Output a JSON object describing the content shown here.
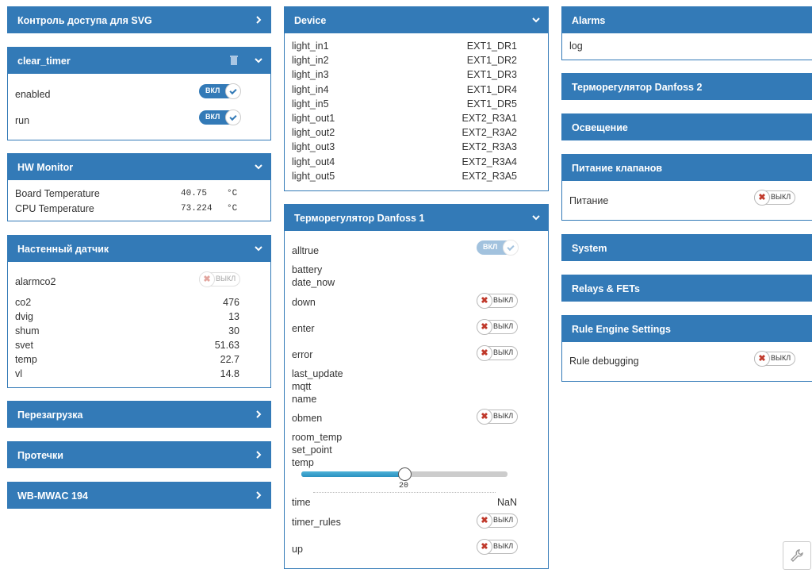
{
  "col1": {
    "svg_access": {
      "title": "Контроль доступа для SVG"
    },
    "clear_timer": {
      "title": "clear_timer",
      "rows": [
        {
          "label": "enabled",
          "toggle": "ВКЛ"
        },
        {
          "label": "run",
          "toggle": "ВКЛ"
        }
      ]
    },
    "hw_monitor": {
      "title": "HW Monitor",
      "rows": [
        {
          "label": "Board Temperature",
          "value": "40.75",
          "unit": "°C"
        },
        {
          "label": "CPU Temperature",
          "value": "73.224",
          "unit": "°C"
        }
      ]
    },
    "wall_sensor": {
      "title": "Настенный датчик",
      "alarm": {
        "label": "alarmco2",
        "toggle": "ВЫКЛ"
      },
      "rows": [
        {
          "label": "co2",
          "value": "476"
        },
        {
          "label": "dvig",
          "value": "13"
        },
        {
          "label": "shum",
          "value": "30"
        },
        {
          "label": "svet",
          "value": "51.63"
        },
        {
          "label": "temp",
          "value": "22.7"
        },
        {
          "label": "vl",
          "value": "14.8"
        }
      ]
    },
    "reboot": {
      "title": "Перезагрузка"
    },
    "leaks": {
      "title": "Протечки"
    },
    "mwac": {
      "title": "WB-MWAC 194"
    }
  },
  "col2": {
    "device": {
      "title": "Device",
      "rows": [
        {
          "label": "light_in1",
          "value": "EXT1_DR1"
        },
        {
          "label": "light_in2",
          "value": "EXT1_DR2"
        },
        {
          "label": "light_in3",
          "value": "EXT1_DR3"
        },
        {
          "label": "light_in4",
          "value": "EXT1_DR4"
        },
        {
          "label": "light_in5",
          "value": "EXT1_DR5"
        },
        {
          "label": "light_out1",
          "value": "EXT2_R3A1"
        },
        {
          "label": "light_out2",
          "value": "EXT2_R3A2"
        },
        {
          "label": "light_out3",
          "value": "EXT2_R3A3"
        },
        {
          "label": "light_out4",
          "value": "EXT2_R3A4"
        },
        {
          "label": "light_out5",
          "value": "EXT2_R3A5"
        }
      ]
    },
    "danfoss1": {
      "title": "Терморегулятор Danfoss 1",
      "alltrue": {
        "label": "alltrue",
        "toggle": "ВКЛ"
      },
      "battery": "battery",
      "date_now": "date_now",
      "down": {
        "label": "down",
        "toggle": "ВЫКЛ"
      },
      "enter": {
        "label": "enter",
        "toggle": "ВЫКЛ"
      },
      "error": {
        "label": "error",
        "toggle": "ВЫКЛ"
      },
      "last_update": "last_update",
      "mqtt": "mqtt",
      "name": "name",
      "obmen": {
        "label": "obmen",
        "toggle": "ВЫКЛ"
      },
      "room_temp": "room_temp",
      "set_point": "set_point",
      "temp": {
        "label": "temp",
        "value": "20",
        "slider_fraction": 0.5
      },
      "time": {
        "label": "time",
        "value": "NaN"
      },
      "timer_rules": {
        "label": "timer_rules",
        "toggle": "ВЫКЛ"
      },
      "up": {
        "label": "up",
        "toggle": "ВЫКЛ"
      }
    }
  },
  "col3": {
    "alarms": {
      "title": "Alarms",
      "log": "log"
    },
    "danfoss2": {
      "title": "Терморегулятор Danfoss 2"
    },
    "lighting": {
      "title": "Освещение"
    },
    "valves": {
      "title": "Питание клапанов",
      "row": {
        "label": "Питание",
        "toggle": "ВЫКЛ"
      }
    },
    "system": {
      "title": "System"
    },
    "relays": {
      "title": "Relays & FETs"
    },
    "rule_engine": {
      "title": "Rule Engine Settings",
      "row": {
        "label": "Rule debugging",
        "toggle": "ВЫКЛ"
      }
    }
  },
  "icons": [
    "chevron-right-icon",
    "chevron-down-icon",
    "trash-icon",
    "check-icon",
    "x-icon",
    "wrench-icon"
  ],
  "colors": {
    "header": "#337ab7",
    "toggle_on": "#337ab7",
    "off_x": "#c0392b"
  }
}
